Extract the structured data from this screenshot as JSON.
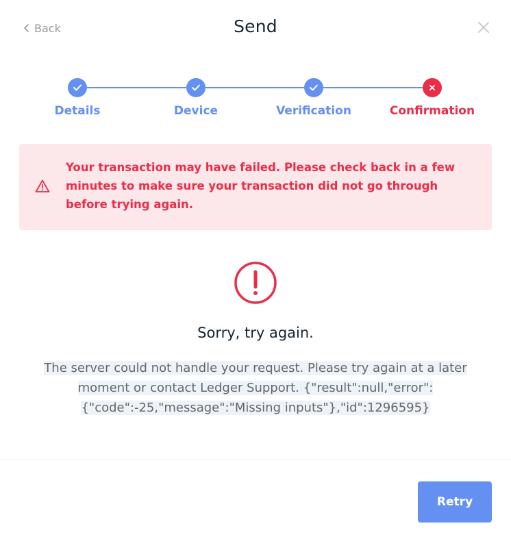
{
  "header": {
    "back_label": "Back",
    "title": "Send",
    "close_icon": "close-icon",
    "back_icon": "chevron-left-icon"
  },
  "stepper": {
    "steps": [
      {
        "label": "Details",
        "status": "done"
      },
      {
        "label": "Device",
        "status": "done"
      },
      {
        "label": "Verification",
        "status": "done"
      },
      {
        "label": "Confirmation",
        "status": "failed"
      }
    ]
  },
  "alert": {
    "icon": "warning-triangle-icon",
    "text": "Your transaction may have failed. Please check back in a few minutes to make sure your transaction did not go through before trying again."
  },
  "error": {
    "icon": "exclamation-circle-icon",
    "title": "Sorry, try again.",
    "line1": "The server could not handle your request. Please try again at a later",
    "line2": "moment or contact Ledger Support. {\"result\":null,\"error\":",
    "line3": "{\"code\":-25,\"message\":\"Missing inputs\"},\"id\":1296595}"
  },
  "footer": {
    "retry_label": "Retry"
  },
  "colors": {
    "accent": "#6490f1",
    "error": "#ea2e49",
    "alert_bg": "#fce7ea",
    "title_text": "#142533",
    "muted_text": "#999999"
  }
}
